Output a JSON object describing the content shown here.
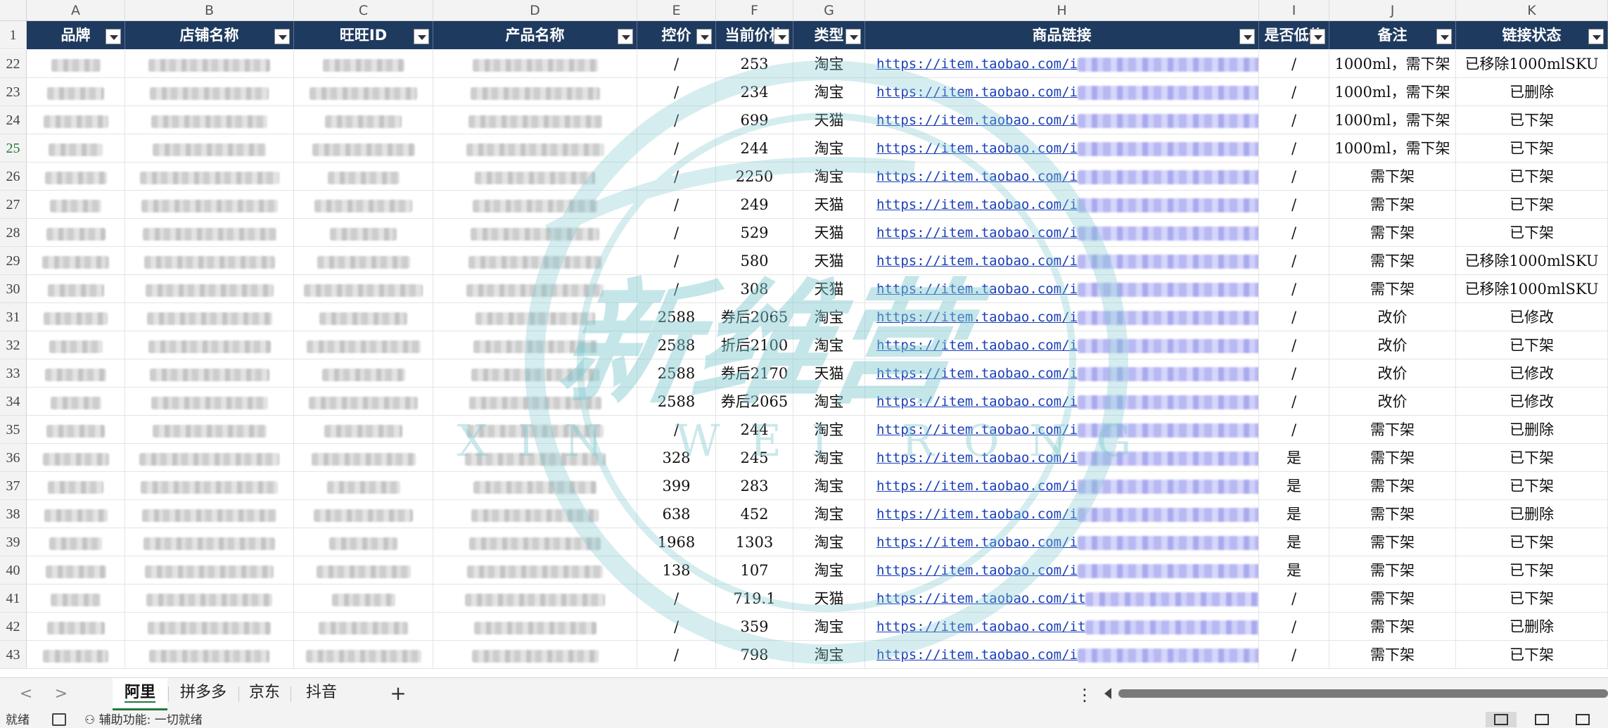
{
  "columns": [
    {
      "letter": "A",
      "header": "品牌"
    },
    {
      "letter": "B",
      "header": "店铺名称"
    },
    {
      "letter": "C",
      "header": "旺旺ID"
    },
    {
      "letter": "D",
      "header": "产品名称"
    },
    {
      "letter": "E",
      "header": "控价"
    },
    {
      "letter": "F",
      "header": "当前价格"
    },
    {
      "letter": "G",
      "header": "类型"
    },
    {
      "letter": "H",
      "header": "商品链接"
    },
    {
      "letter": "I",
      "header": "是否低价"
    },
    {
      "letter": "J",
      "header": "备注"
    },
    {
      "letter": "K",
      "header": "链接状态"
    }
  ],
  "header_row_number": "1",
  "rows": [
    {
      "num": "22",
      "price_ctrl": "/",
      "current": "253",
      "type": "淘宝",
      "link": "https://item.taobao.com/i",
      "low": "/",
      "note": "1000ml，需下架",
      "status": "已移除1000mlSKU"
    },
    {
      "num": "23",
      "price_ctrl": "/",
      "current": "234",
      "type": "淘宝",
      "link": "https://item.taobao.com/i",
      "low": "/",
      "note": "1000ml，需下架",
      "status": "已删除"
    },
    {
      "num": "24",
      "price_ctrl": "/",
      "current": "699",
      "type": "天猫",
      "link": "https://item.taobao.com/i",
      "low": "/",
      "note": "1000ml，需下架",
      "status": "已下架"
    },
    {
      "num": "25",
      "price_ctrl": "/",
      "current": "244",
      "type": "淘宝",
      "link": "https://item.taobao.com/i",
      "low": "/",
      "note": "1000ml，需下架",
      "status": "已下架"
    },
    {
      "num": "26",
      "price_ctrl": "/",
      "current": "2250",
      "type": "淘宝",
      "link": "https://item.taobao.com/i",
      "low": "/",
      "note": "需下架",
      "status": "已下架"
    },
    {
      "num": "27",
      "price_ctrl": "/",
      "current": "249",
      "type": "天猫",
      "link": "https://item.taobao.com/i",
      "low": "/",
      "note": "需下架",
      "status": "已下架"
    },
    {
      "num": "28",
      "price_ctrl": "/",
      "current": "529",
      "type": "天猫",
      "link": "https://item.taobao.com/i",
      "low": "/",
      "note": "需下架",
      "status": "已下架"
    },
    {
      "num": "29",
      "price_ctrl": "/",
      "current": "580",
      "type": "天猫",
      "link": "https://item.taobao.com/i",
      "low": "/",
      "note": "需下架",
      "status": "已移除1000mlSKU"
    },
    {
      "num": "30",
      "price_ctrl": "/",
      "current": "308",
      "type": "天猫",
      "link": "https://item.taobao.com/i",
      "low": "/",
      "note": "需下架",
      "status": "已移除1000mlSKU"
    },
    {
      "num": "31",
      "price_ctrl": "2588",
      "current": "券后2065",
      "type": "淘宝",
      "link": "https://item.taobao.com/i",
      "low": "/",
      "note": "改价",
      "status": "已修改"
    },
    {
      "num": "32",
      "price_ctrl": "2588",
      "current": "折后2100",
      "type": "淘宝",
      "link": "https://item.taobao.com/i",
      "low": "/",
      "note": "改价",
      "status": "已下架"
    },
    {
      "num": "33",
      "price_ctrl": "2588",
      "current": "券后2170",
      "type": "天猫",
      "link": "https://item.taobao.com/i",
      "low": "/",
      "note": "改价",
      "status": "已修改"
    },
    {
      "num": "34",
      "price_ctrl": "2588",
      "current": "券后2065",
      "type": "淘宝",
      "link": "https://item.taobao.com/i",
      "low": "/",
      "note": "改价",
      "status": "已修改"
    },
    {
      "num": "35",
      "price_ctrl": "/",
      "current": "244",
      "type": "淘宝",
      "link": "https://item.taobao.com/i",
      "low": "/",
      "note": "需下架",
      "status": "已删除"
    },
    {
      "num": "36",
      "price_ctrl": "328",
      "current": "245",
      "type": "淘宝",
      "link": "https://item.taobao.com/i",
      "low": "是",
      "note": "需下架",
      "status": "已下架"
    },
    {
      "num": "37",
      "price_ctrl": "399",
      "current": "283",
      "type": "淘宝",
      "link": "https://item.taobao.com/i",
      "low": "是",
      "note": "需下架",
      "status": "已下架"
    },
    {
      "num": "38",
      "price_ctrl": "638",
      "current": "452",
      "type": "淘宝",
      "link": "https://item.taobao.com/i",
      "low": "是",
      "note": "需下架",
      "status": "已删除"
    },
    {
      "num": "39",
      "price_ctrl": "1968",
      "current": "1303",
      "type": "淘宝",
      "link": "https://item.taobao.com/i",
      "low": "是",
      "note": "需下架",
      "status": "已下架"
    },
    {
      "num": "40",
      "price_ctrl": "138",
      "current": "107",
      "type": "淘宝",
      "link": "https://item.taobao.com/i",
      "low": "是",
      "note": "需下架",
      "status": "已下架"
    },
    {
      "num": "41",
      "price_ctrl": "/",
      "current": "719.1",
      "type": "天猫",
      "link": "https://item.taobao.com/it",
      "low": "/",
      "note": "需下架",
      "status": "已下架"
    },
    {
      "num": "42",
      "price_ctrl": "/",
      "current": "359",
      "type": "淘宝",
      "link": "https://item.taobao.com/it",
      "low": "/",
      "note": "需下架",
      "status": "已删除"
    },
    {
      "num": "43",
      "price_ctrl": "/",
      "current": "798",
      "type": "淘宝",
      "link": "https://item.taobao.com/i",
      "low": "/",
      "note": "需下架",
      "status": "已下架"
    }
  ],
  "sheet_tabs": [
    "阿里",
    "拼多多",
    "京东",
    "抖音"
  ],
  "active_tab": "阿里",
  "add_tab_symbol": "+",
  "more_symbol": "⋮",
  "nav_prev": "<",
  "nav_next": ">",
  "watermark": {
    "text_main": "新维营",
    "text_sub": "XIN WEI RONG",
    "color": "#7ec8cf"
  },
  "status_bar": {
    "ready": "就绪",
    "accessibility": "辅助功能: 一切就绪"
  },
  "colors": {
    "header_bg": "#1f3a5f",
    "link": "#1a3fb8",
    "active_tab_accent": "#1f7a3a"
  }
}
